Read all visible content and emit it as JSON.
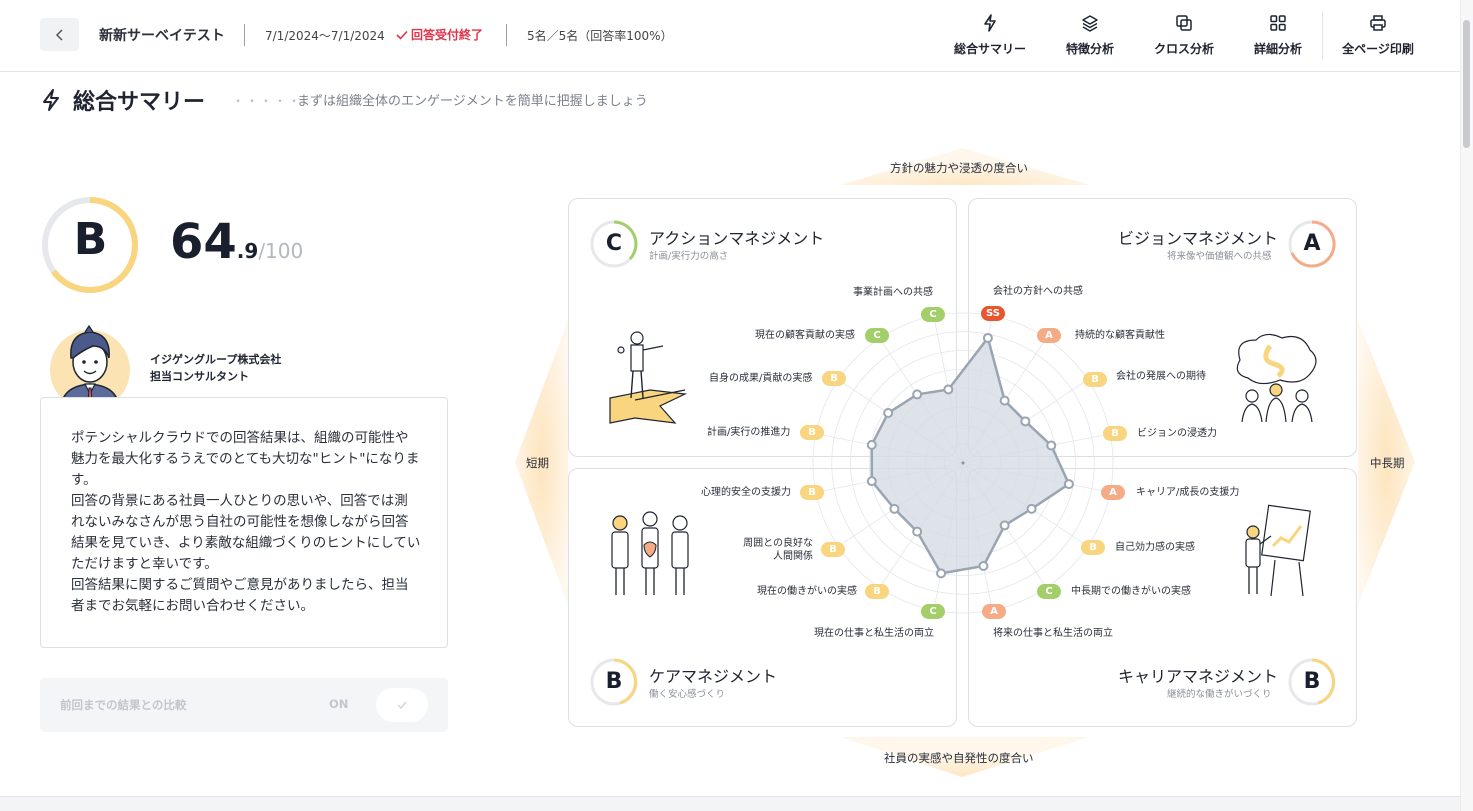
{
  "header": {
    "survey_name": "新新サーベイテスト",
    "period": "7/1/2024〜7/1/2024",
    "status": "回答受付終了",
    "response_count": "5名／5名（回答率100%）",
    "nav": [
      {
        "label": "総合サマリー",
        "icon": "bolt-icon"
      },
      {
        "label": "特徴分析",
        "icon": "layers-icon"
      },
      {
        "label": "クロス分析",
        "icon": "overlap-squares-icon"
      },
      {
        "label": "詳細分析",
        "icon": "grid-icon"
      },
      {
        "label": "全ページ印刷",
        "icon": "printer-icon"
      }
    ]
  },
  "page": {
    "title": "総合サマリー",
    "dots": "・・・・・",
    "subtitle": "まずは組織全体のエンゲージメントを簡単に把握しましょう"
  },
  "overall": {
    "grade": "B",
    "score_int": "64",
    "score_dec": ".9",
    "score_max": "/100",
    "score": 64.9
  },
  "consultant": {
    "company": "イジゲングループ株式会社",
    "role": "担当コンサルタント",
    "message": "ポテンシャルクラウドでの回答結果は、組織の可能性や魅力を最大化するうえでのとても大切な\"ヒント\"になります。\n回答の背景にある社員一人ひとりの思いや、回答では測れないみなさんが思う自社の可能性を想像しながら回答結果を見ていき、より素敵な組織づくりのヒントにしていただけますと幸いです。\n回答結果に関するご質問やご意見がありましたら、担当者までお気軽にお問い合わせください。"
  },
  "compare": {
    "label": "前回までの結果との比較",
    "state": "ON"
  },
  "axes": {
    "top": "方針の魅力や浸透の度合い",
    "bottom": "社員の実感や自発性の度合い",
    "left": "短期",
    "right": "中長期"
  },
  "panels": {
    "action": {
      "title": "アクションマネジメント",
      "sub": "計画/実行力の高さ",
      "grade": "C"
    },
    "vision": {
      "title": "ビジョンマネジメント",
      "sub": "将来像や価値観への共感",
      "grade": "A"
    },
    "care": {
      "title": "ケアマネジメント",
      "sub": "働く安心感づくり",
      "grade": "B"
    },
    "career": {
      "title": "キャリアマネジメント",
      "sub": "継続的な働きがいづくり",
      "grade": "B"
    }
  },
  "radar_items": [
    {
      "label": "会社の方針への共感",
      "grade": "SS",
      "value": 0.85
    },
    {
      "label": "持続的な顧客貢献性",
      "grade": "A",
      "value": 0.5
    },
    {
      "label": "会社の発展への期待",
      "grade": "B",
      "value": 0.5
    },
    {
      "label": "ビジョンの浸透力",
      "grade": "B",
      "value": 0.6
    },
    {
      "label": "キャリア/成長の支援力",
      "grade": "A",
      "value": 0.72
    },
    {
      "label": "自己効力感の実感",
      "grade": "B",
      "value": 0.55
    },
    {
      "label": "中長期での働きがいの実感",
      "grade": "C",
      "value": 0.5
    },
    {
      "label": "将来の仕事と私生活の両立",
      "grade": "A",
      "value": 0.7
    },
    {
      "label": "現在の仕事と私生活の両立",
      "grade": "C",
      "value": 0.75
    },
    {
      "label": "現在の働きがいの実感",
      "grade": "B",
      "value": 0.55
    },
    {
      "label": "周囲との良好な人間関係",
      "grade": "B",
      "value": 0.55
    },
    {
      "label": "心理的安全の支援力",
      "grade": "B",
      "value": 0.62
    },
    {
      "label": "計画/実行の推進力",
      "grade": "B",
      "value": 0.62
    },
    {
      "label": "自身の成果/貢献の実感",
      "grade": "B",
      "value": 0.6
    },
    {
      "label": "現在の顧客貢献の実感",
      "grade": "C",
      "value": 0.55
    },
    {
      "label": "事業計画への共感",
      "grade": "C",
      "value": 0.5
    }
  ],
  "colors": {
    "C": "#a3cf6a",
    "B": "#f8d57e",
    "A": "#f5ab86",
    "SS": "#e8552f",
    "radar_fill": "#d6dbe3",
    "radar_stroke": "#9aa5b2"
  }
}
